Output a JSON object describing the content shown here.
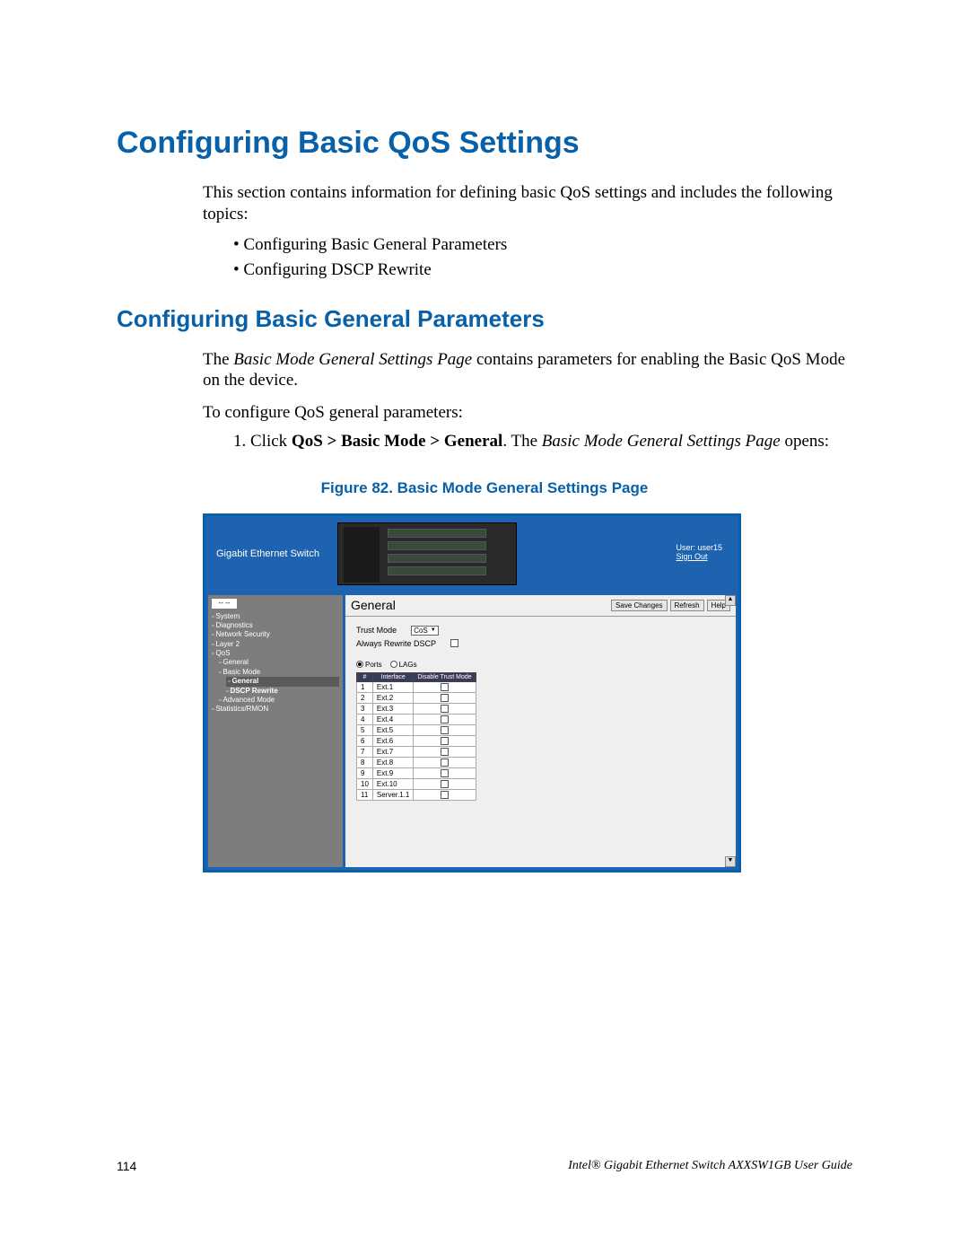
{
  "h1": "Configuring Basic QoS Settings",
  "intro": "This section contains information for defining basic QoS settings and includes the following topics:",
  "bullets": [
    "Configuring Basic General Parameters",
    "Configuring DSCP Rewrite"
  ],
  "h2": "Configuring Basic General Parameters",
  "p2_a": "The ",
  "p2_i": "Basic Mode General Settings Page",
  "p2_b": " contains parameters for enabling the Basic QoS Mode on the device.",
  "p3": "To configure QoS general parameters:",
  "step1_a": "1.   Click ",
  "step1_bold": "QoS > Basic Mode > General",
  "step1_b": ". The ",
  "step1_i": "Basic Mode General Settings Page",
  "step1_c": " opens:",
  "fig_caption": "Figure 82. Basic Mode General Settings Page",
  "fig": {
    "product": "Gigabit Ethernet Switch",
    "user": "User: user15",
    "signout": "Sign Out",
    "zoom": "-- --",
    "nav": [
      {
        "t": "System",
        "l": 1
      },
      {
        "t": "Diagnostics",
        "l": 1
      },
      {
        "t": "Network Security",
        "l": 1
      },
      {
        "t": "Layer 2",
        "l": 1
      },
      {
        "t": "QoS",
        "l": 1
      },
      {
        "t": "General",
        "l": 2
      },
      {
        "t": "Basic Mode",
        "l": 2
      },
      {
        "t": "General",
        "l": 3,
        "sel": true
      },
      {
        "t": "DSCP Rewrite",
        "l": 3
      },
      {
        "t": "Advanced Mode",
        "l": 2
      },
      {
        "t": "Statistics/RMON",
        "l": 1
      }
    ],
    "panel_title": "General",
    "buttons": [
      "Save Changes",
      "Refresh",
      "Help"
    ],
    "trust_label": "Trust Mode",
    "trust_value": "CoS",
    "rewrite_label": "Always Rewrite DSCP",
    "radio_ports": "Ports",
    "radio_lags": "LAGs",
    "th": [
      "#",
      "Interface",
      "Disable Trust Mode"
    ],
    "rows": [
      {
        "n": "1",
        "if": "Ext.1"
      },
      {
        "n": "2",
        "if": "Ext.2"
      },
      {
        "n": "3",
        "if": "Ext.3"
      },
      {
        "n": "4",
        "if": "Ext.4"
      },
      {
        "n": "5",
        "if": "Ext.5"
      },
      {
        "n": "6",
        "if": "Ext.6"
      },
      {
        "n": "7",
        "if": "Ext.7"
      },
      {
        "n": "8",
        "if": "Ext.8"
      },
      {
        "n": "9",
        "if": "Ext.9"
      },
      {
        "n": "10",
        "if": "Ext.10"
      },
      {
        "n": "11",
        "if": "Server.1.1"
      }
    ]
  },
  "page_number": "114",
  "guide": "Intel® Gigabit Ethernet Switch AXXSW1GB User Guide"
}
